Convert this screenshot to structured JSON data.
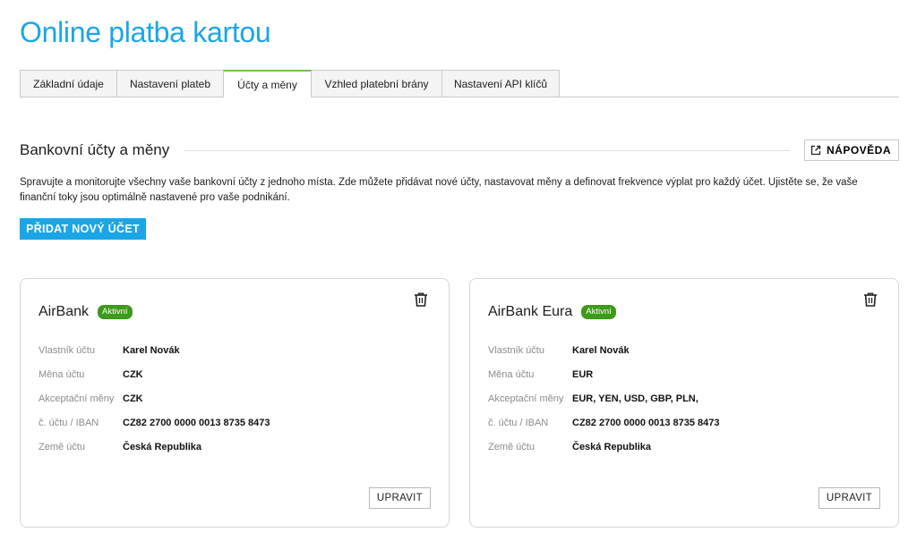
{
  "page": {
    "title": "Online platba kartou"
  },
  "tabs": [
    {
      "label": "Základní údaje"
    },
    {
      "label": "Nastavení plateb"
    },
    {
      "label": "Účty a měny",
      "active": true
    },
    {
      "label": "Vzhled platební brány"
    },
    {
      "label": "Nastavení API klíčů"
    }
  ],
  "section": {
    "title": "Bankovní účty a měny",
    "help_label": "NÁPOVĚDA",
    "description": "Spravujte a monitorujte všechny vaše bankovní účty z jednoho místa. Zde můžete přidávat nové účty, nastavovat měny a definovat frekvence výplat pro každý účet. Ujistěte se, že vaše finanční toky jsou optimálně nastavené pro vaše podnikání.",
    "add_button": "PŘIDAT NOVÝ ÚČET"
  },
  "labels": {
    "owner": "Vlastník účtu",
    "currency": "Měna účtu",
    "accepted": "Akceptační měny",
    "iban": "č. účtu / IBAN",
    "country": "Země účtu",
    "edit": "UPRAVIT"
  },
  "accounts": [
    {
      "name": "AirBank",
      "status": "Aktivní",
      "owner": "Karel Novák",
      "currency": "CZK",
      "accepted": "CZK",
      "iban": "CZ82 2700 0000 0013 8735 8473",
      "country": "Česká Republika"
    },
    {
      "name": "AirBank Eura",
      "status": "Aktivní",
      "owner": "Karel Novák",
      "currency": "EUR",
      "accepted": "EUR, YEN, USD, GBP, PLN,",
      "iban": "CZ82 2700 0000 0013 8735 8473",
      "country": "Česká Republika"
    }
  ],
  "icons": {
    "help": "external-link-icon",
    "delete": "trash-icon"
  },
  "colors": {
    "accent": "#1aa6e6",
    "active_tab": "#6cc24a",
    "status_active": "#3d9a1a"
  }
}
